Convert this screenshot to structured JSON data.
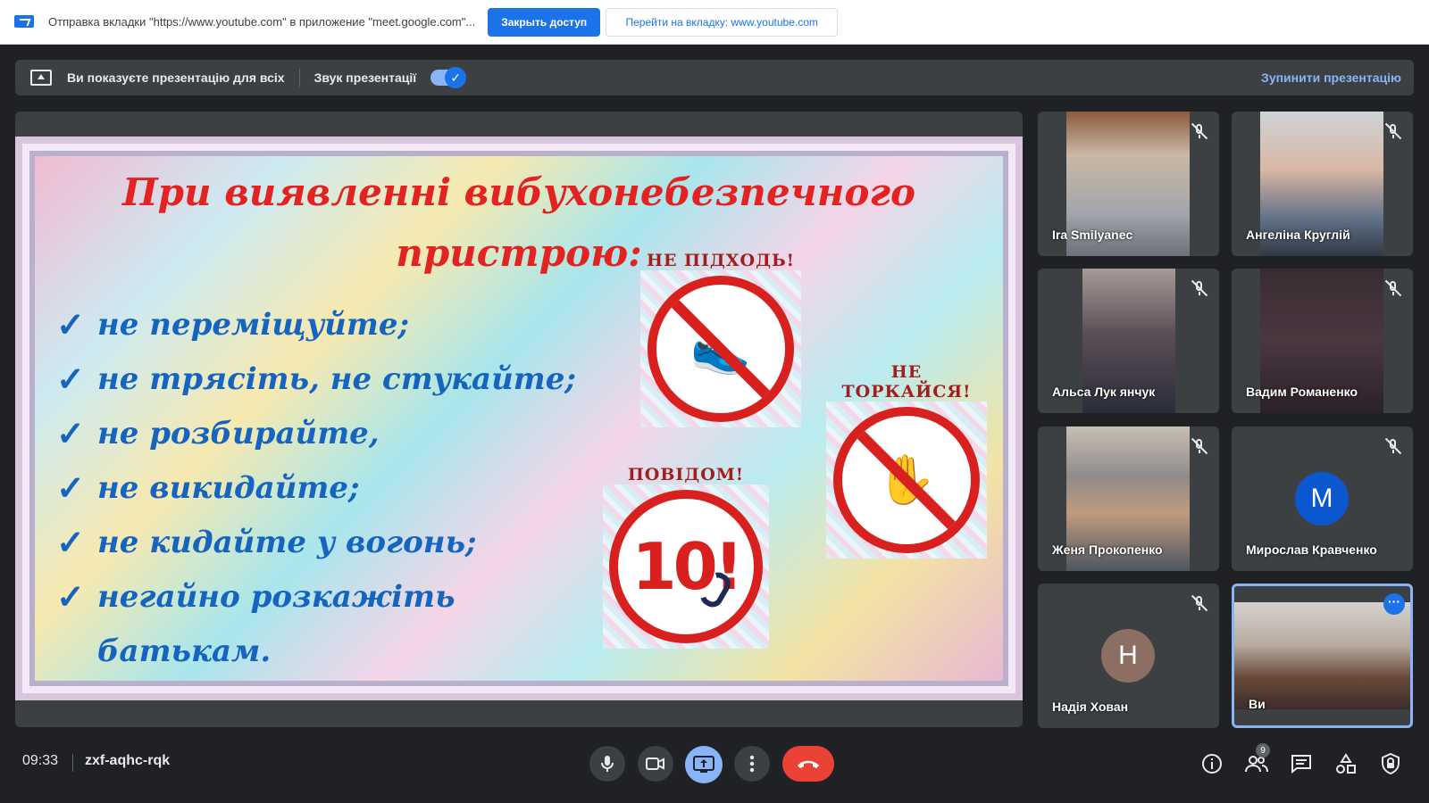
{
  "share_bar": {
    "message": "Отправка вкладки \"https://www.youtube.com\" в приложение \"meet.google.com\"...",
    "stop_button": "Закрыть доступ",
    "goto_button": "Перейти на вкладку: www.youtube.com"
  },
  "presenting_bar": {
    "status": "Ви показуєте презентацію для всіх",
    "audio_label": "Звук презентації",
    "audio_on": true,
    "stop_link": "Зупинити презентацію"
  },
  "slide": {
    "title_line1": "При виявленні вибухонебезпечного",
    "title_line2": "пристрою:",
    "bullets": [
      "не переміщуйте;",
      "не трясіть, не стукайте;",
      "не розбирайте,",
      "не викидайте;",
      "не кидайте у вогонь;",
      "негайно розкажіть"
    ],
    "bullet_continuation": "батькам.",
    "sign_dont_approach": "НЕ ПІДХОДЬ!",
    "sign_dont_touch": "НЕ ТОРКАЙСЯ!",
    "sign_report": "ПОВІДОМ!",
    "emergency_number": "10!"
  },
  "participants": [
    {
      "name": "Ira Smilyanec",
      "muted": true
    },
    {
      "name": "Ангеліна Круглій",
      "muted": true
    },
    {
      "name": "Альса Лук янчук",
      "muted": true
    },
    {
      "name": "Вадим Романенко",
      "muted": true
    },
    {
      "name": "Женя Прокопенко",
      "muted": true
    },
    {
      "name": "Мирослав Кравченко",
      "muted": true,
      "initial": "М",
      "avatar_color": "#0b57d0"
    },
    {
      "name": "Надія Хован",
      "muted": true,
      "initial": "Н",
      "avatar_color": "#8d6e63"
    },
    {
      "name": "Ви",
      "self": true
    }
  ],
  "bottom_bar": {
    "time": "09:33",
    "meeting_code": "zxf-aqhc-rqk",
    "participant_count": "9"
  },
  "icons": {
    "mic": "microphone-icon",
    "camera": "camera-icon",
    "present": "present-screen-icon",
    "more": "more-vert-icon",
    "hangup": "hang-up-icon",
    "info": "info-icon",
    "people": "people-icon",
    "chat": "chat-icon",
    "activities": "activities-icon",
    "host": "host-controls-icon"
  },
  "colors": {
    "accent": "#1a73e8",
    "hangup": "#ea4335",
    "background": "#202124",
    "tile": "#3c4043"
  }
}
